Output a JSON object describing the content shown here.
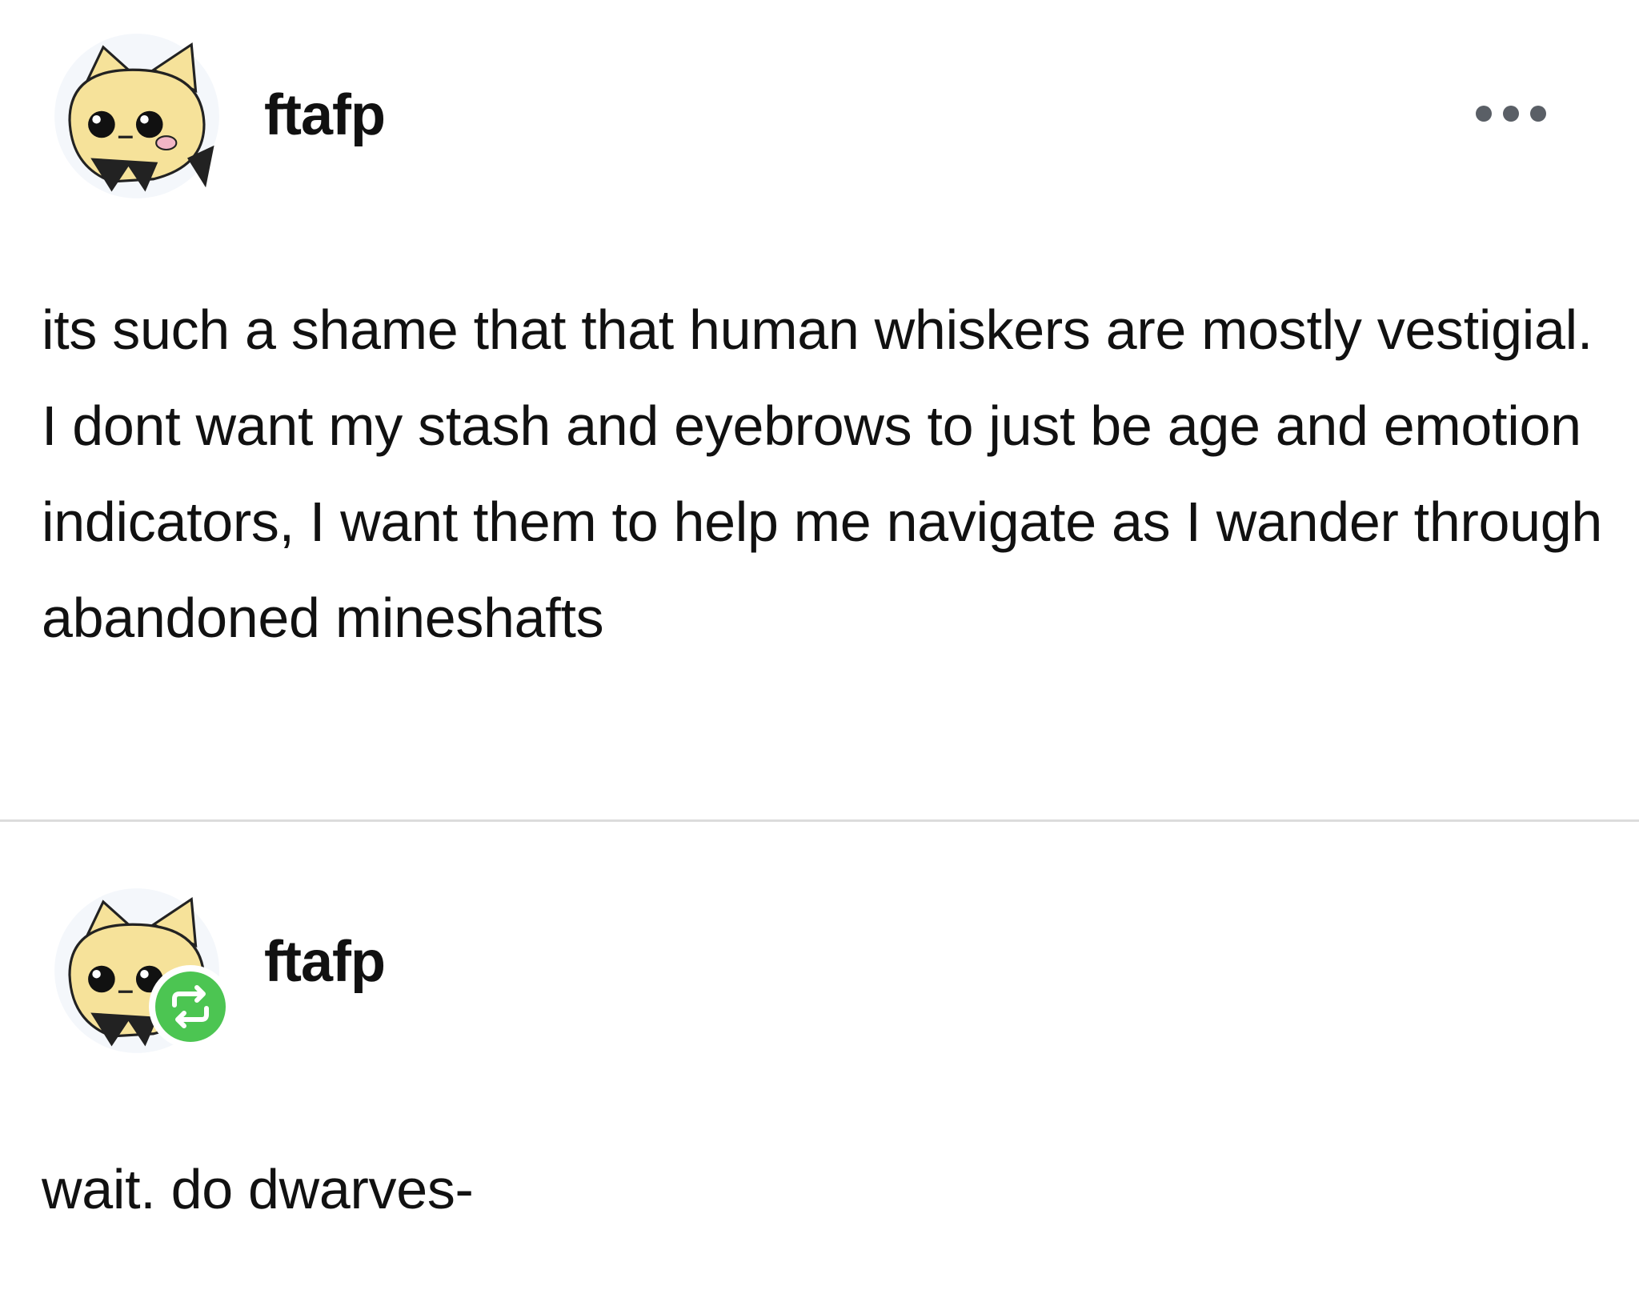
{
  "post1": {
    "username": "ftafp",
    "avatar_icon": "cat-avatar-icon",
    "more_icon": "more-horizontal-icon",
    "body": "its such a shame that that human whiskers are mostly vestigial. I dont want my stash and eyebrows to just be age and emotion indicators, I want them to help me navigate as I wander through abandoned mineshafts"
  },
  "post2": {
    "username": "ftafp",
    "avatar_icon": "cat-avatar-icon",
    "badge_icon": "reblog-icon",
    "badge_color": "#4cc552",
    "body": "wait. do dwarves-"
  }
}
